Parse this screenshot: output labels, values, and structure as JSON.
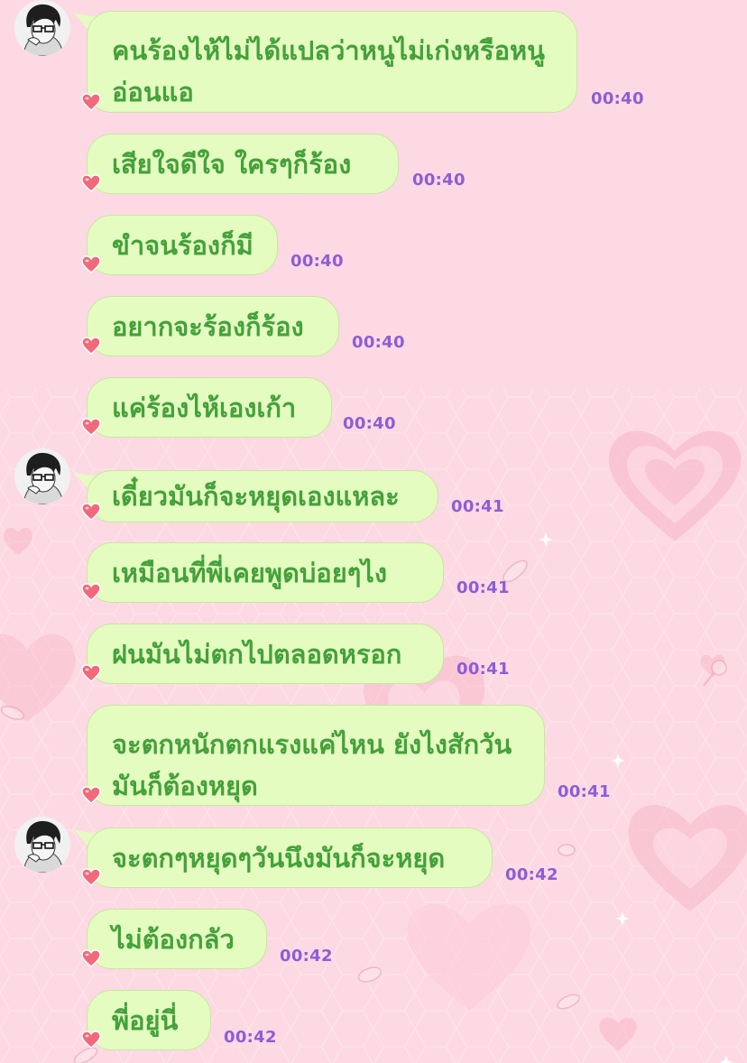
{
  "theme": {
    "background": "#fdd9e3",
    "bubble_fill": "#e4fcc0",
    "bubble_border": "#c9e6a2",
    "message_text_color": "#44a13a",
    "timestamp_color": "#8e5dd6",
    "heart_color": "#f2697c"
  },
  "messages": [
    {
      "text": "คนร้องไห้ไม่ได้แปลว่าหนูไม่เก่งหรือหนูอ่อนแอ",
      "time": "00:40",
      "icon": "heart-icon"
    },
    {
      "text": "เสียใจดีใจ ใครๆก็ร้อง",
      "time": "00:40",
      "icon": "heart-icon"
    },
    {
      "text": "ขำจนร้องก็มี",
      "time": "00:40",
      "icon": "heart-icon"
    },
    {
      "text": "อยากจะร้องก็ร้อง",
      "time": "00:40",
      "icon": "heart-icon"
    },
    {
      "text": "แค่ร้องไห้เองเก้า",
      "time": "00:40",
      "icon": "heart-icon"
    },
    {
      "text": "เดี๋ยวมันก็จะหยุดเองแหละ",
      "time": "00:41",
      "icon": "heart-icon"
    },
    {
      "text": "เหมือนที่พี่เคยพูดบ่อยๆไง",
      "time": "00:41",
      "icon": "heart-icon"
    },
    {
      "text": "ฝนมันไม่ตกไปตลอดหรอก",
      "time": "00:41",
      "icon": "heart-icon"
    },
    {
      "text": "จะตกหนักตกแรงแค่ไหน ยังไงสักวันมันก็ต้องหยุด",
      "time": "00:41",
      "icon": "heart-icon"
    },
    {
      "text": "จะตกๆหยุดๆวันนึงมันก็จะหยุด",
      "time": "00:42",
      "icon": "heart-icon"
    },
    {
      "text": "ไม่ต้องกลัว",
      "time": "00:42",
      "icon": "heart-icon"
    },
    {
      "text": "พี่อยู่นี่",
      "time": "00:42",
      "icon": "heart-icon"
    }
  ]
}
